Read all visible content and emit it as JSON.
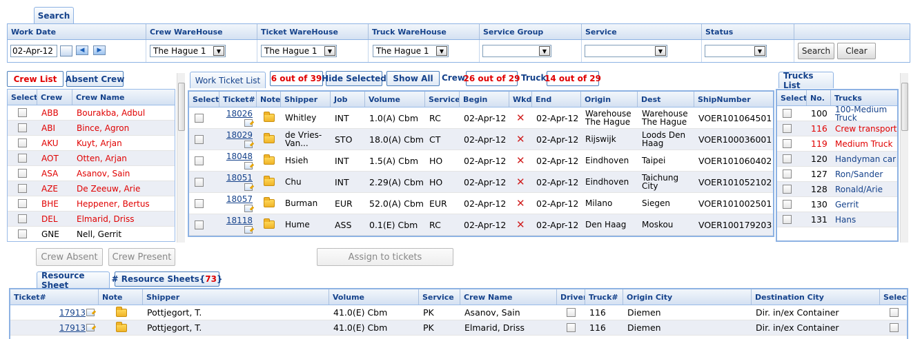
{
  "search": {
    "tab": "Search",
    "headers": [
      "Work Date",
      "Crew WareHouse",
      "Ticket WareHouse",
      "Truck WareHouse",
      "Service Group",
      "Service",
      "Status"
    ],
    "work_date": "02-Apr-12",
    "crew_warehouse": "The Hague 1",
    "ticket_warehouse": "The Hague 1",
    "truck_warehouse": "The Hague 1",
    "service_group": "",
    "service": "",
    "status": "",
    "search_button": "Search",
    "clear_button": "Clear"
  },
  "crew": {
    "tab_crew_list": "Crew List",
    "tab_absent_crew": "Absent Crew",
    "headers": [
      "Select",
      "Crew",
      "Crew Name"
    ],
    "rows": [
      {
        "code": "ABB",
        "name": "Bourakba, Adbul",
        "red": true
      },
      {
        "code": "ABI",
        "name": "Bince, Agron",
        "red": true
      },
      {
        "code": "AKU",
        "name": "Kuyt, Arjan",
        "red": true
      },
      {
        "code": "AOT",
        "name": "Otten, Arjan",
        "red": true
      },
      {
        "code": "ASA",
        "name": "Asanov, Sain",
        "red": true
      },
      {
        "code": "AZE",
        "name": "De Zeeuw, Arie",
        "red": true
      },
      {
        "code": "BHE",
        "name": "Heppener, Bertus",
        "red": true
      },
      {
        "code": "DEL",
        "name": "Elmarid, Driss",
        "red": true
      },
      {
        "code": "GNE",
        "name": "Nell, Gerrit",
        "red": false
      }
    ],
    "crew_absent_button": "Crew Absent",
    "crew_present_button": "Crew Present"
  },
  "tickets": {
    "tab": "Work Ticket List",
    "count_badge": "6 out of 39",
    "hide_selected": "Hide Selected",
    "show_all": "Show All",
    "crew_label": "Crew",
    "crew_count": "26 out of 29",
    "truck_label": "Truck",
    "truck_count": "14 out of 29",
    "headers": [
      "Select",
      "Ticket#",
      "Note",
      "Shipper",
      "Job",
      "Volume",
      "Service",
      "Begin",
      "Wkd",
      "End",
      "Origin",
      "Dest",
      "ShipNumber"
    ],
    "rows": [
      {
        "ticket": "18026",
        "shipper": "Whitley",
        "job": "INT",
        "volume": "1.0(A) Cbm",
        "service": "RC",
        "begin": "02-Apr-12",
        "end": "02-Apr-12",
        "origin": "Warehouse The Hague",
        "dest": "Warehouse The Hague",
        "ship": "VOER101064501"
      },
      {
        "ticket": "18029",
        "shipper": "de Vries-Van...",
        "job": "STO",
        "volume": "18.0(A) Cbm",
        "service": "CT",
        "begin": "02-Apr-12",
        "end": "02-Apr-12",
        "origin": "Rijswijk",
        "dest": "Loods Den Haag",
        "ship": "VOER100036001"
      },
      {
        "ticket": "18048",
        "shipper": "Hsieh",
        "job": "INT",
        "volume": "1.5(A) Cbm",
        "service": "HO",
        "begin": "02-Apr-12",
        "end": "02-Apr-12",
        "origin": "Eindhoven",
        "dest": "Taipei",
        "ship": "VOER101060402"
      },
      {
        "ticket": "18051",
        "shipper": "Chu",
        "job": "INT",
        "volume": "2.29(A) Cbm",
        "service": "HO",
        "begin": "02-Apr-12",
        "end": "02-Apr-12",
        "origin": "Eindhoven",
        "dest": "Taichung City",
        "ship": "VOER101052102"
      },
      {
        "ticket": "18057",
        "shipper": "Burman",
        "job": "EUR",
        "volume": "52.0(A) Cbm",
        "service": "EUR",
        "begin": "02-Apr-12",
        "end": "02-Apr-12",
        "origin": "Milano",
        "dest": "Siegen",
        "ship": "VOER101002501"
      },
      {
        "ticket": "18118",
        "shipper": "Hume",
        "job": "ASS",
        "volume": "0.1(E) Cbm",
        "service": "RC",
        "begin": "02-Apr-12",
        "end": "02-Apr-12",
        "origin": "Den Haag",
        "dest": "Moskou",
        "ship": "VOER100179203"
      }
    ],
    "assign_button": "Assign to tickets"
  },
  "trucks": {
    "tab": "Trucks List",
    "headers": [
      "Select",
      "No.",
      "Trucks"
    ],
    "rows": [
      {
        "no": "100",
        "name": "100-Medium Truck",
        "red": false
      },
      {
        "no": "116",
        "name": "Crew transport",
        "red": true
      },
      {
        "no": "119",
        "name": "Medium Truck",
        "red": true
      },
      {
        "no": "120",
        "name": "Handyman car",
        "red": false
      },
      {
        "no": "127",
        "name": "Ron/Sander",
        "red": false
      },
      {
        "no": "128",
        "name": "Ronald/Arie",
        "red": false
      },
      {
        "no": "130",
        "name": "Gerrit",
        "red": false
      },
      {
        "no": "131",
        "name": "Hans",
        "red": false
      }
    ]
  },
  "resource": {
    "tab": "Resource Sheet",
    "tab2_prefix": "# Resource Sheets{ ",
    "tab2_count": "73",
    "tab2_suffix": " }",
    "headers": [
      "Ticket#",
      "Note",
      "Shipper",
      "Volume",
      "Service",
      "Crew Name",
      "Driver",
      "Truck#",
      "Origin City",
      "Destination City",
      "Select"
    ],
    "rows": [
      {
        "ticket": "17913",
        "shipper": "Pottjegort, T.",
        "volume": "41.0(E) Cbm",
        "service": "PK",
        "crew": "Asanov, Sain",
        "truck": "116",
        "origin": "Diemen",
        "dest": "Dir. in/ex Container"
      },
      {
        "ticket": "17913",
        "shipper": "Pottjegort, T.",
        "volume": "41.0(E) Cbm",
        "service": "PK",
        "crew": "Elmarid, Driss",
        "truck": "116",
        "origin": "Diemen",
        "dest": "Dir. in/ex Container"
      }
    ]
  }
}
